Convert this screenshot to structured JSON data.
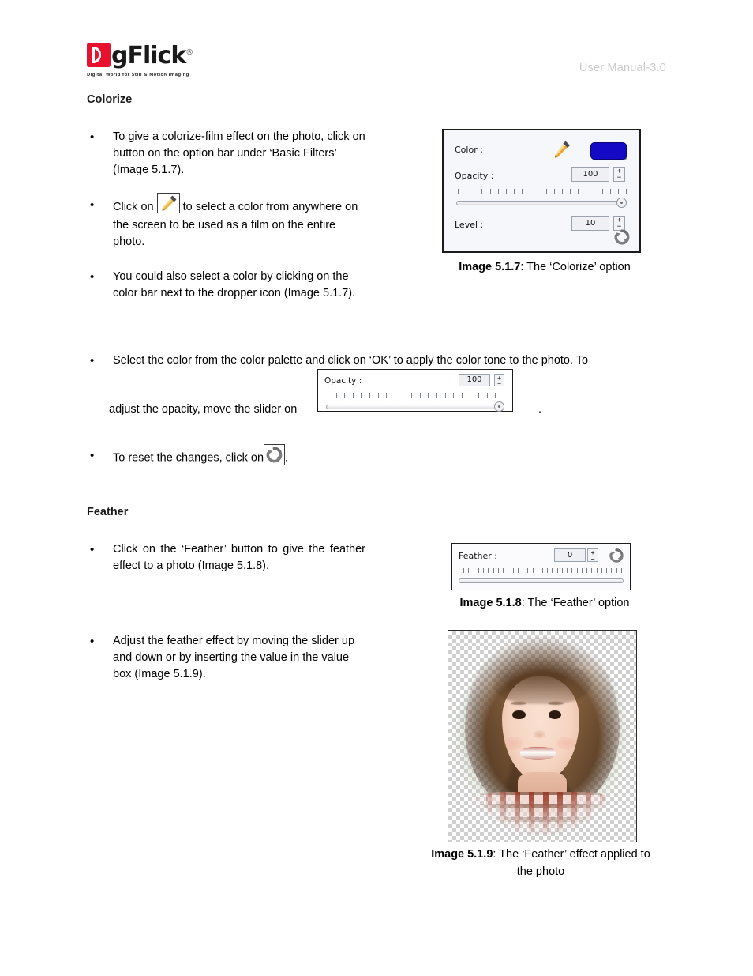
{
  "header": {
    "logo_text": "gFlick",
    "logo_mark_letter": "D",
    "logo_registered": "®",
    "tagline": "Digital World for Still & Motion Imaging",
    "manual_label": "User Manual-3.0"
  },
  "sections": [
    {
      "id": "colorize",
      "title": "Colorize",
      "bullets": [
        {
          "id": "colorize-b1",
          "marker": "•",
          "text": "To give a colorize-film effect on the photo, click on button on the option bar under ‘Basic Filters’ (Image 5.1.7)."
        },
        {
          "id": "colorize-b2",
          "marker": "•",
          "pre": "Click on",
          "inline_icon": "dropper-icon",
          "post": "to select a color from anywhere on the screen to be used as a film on the entire photo."
        },
        {
          "id": "colorize-b3",
          "marker": "•",
          "text": "You could also select a color by clicking on the color bar next to the dropper icon (Image 5.1.7)."
        },
        {
          "id": "colorize-b4",
          "marker": "•",
          "pre": "Select the color from the color palette and click on ‘OK’ to apply the color tone to the photo. To",
          "mid": "adjust the opacity, move the slider on",
          "post": "."
        },
        {
          "id": "colorize-b5",
          "marker": "•",
          "pre": "To reset the changes, click on",
          "inline_icon": "reset-icon",
          "post": "."
        }
      ]
    },
    {
      "id": "feather",
      "title": "Feather",
      "bullets": [
        {
          "id": "feather-b1",
          "marker": "•",
          "text": "Click on the ‘Feather’ button to give the feather effect to a photo (Image 5.1.8)."
        },
        {
          "id": "feather-b2",
          "marker": "•",
          "text": "Adjust the feather effect by moving the slider up and down or by inserting the value in the value box (Image 5.1.9)."
        }
      ]
    }
  ],
  "figures": {
    "colorize_panel": {
      "color_label": "Color :",
      "color_swatch_hex": "#1409c4",
      "dropper_icon": "dropper-icon",
      "opacity_label": "Opacity :",
      "opacity_value": "100",
      "opacity_slider_position": "right",
      "level_label": "Level :",
      "level_value": "10",
      "reset_icon": "reset-icon",
      "spin_up": "+",
      "spin_down": "−",
      "tick_count": 22,
      "caption_bold": "Image 5.1.7",
      "caption_rest": ": The ‘Colorize’ option"
    },
    "opacity_inline": {
      "label": "Opacity :",
      "value": "100",
      "spin_up": "+",
      "spin_down": "−",
      "slider_position": "right",
      "tick_count": 22
    },
    "feather_panel": {
      "label": "Feather :",
      "value": "0",
      "spin_up": "+",
      "spin_down": "−",
      "slider_position": "left",
      "reset_icon": "reset-icon",
      "tick_count": 34,
      "caption_bold": "Image 5.1.8",
      "caption_rest": ": The ‘Feather’ option"
    },
    "feather_photo": {
      "alt_name": "girl-portrait-photo",
      "caption_bold": "Image 5.1.9",
      "caption_rest": ": The ‘Feather’ effect applied to",
      "caption_line2": "the photo"
    }
  }
}
